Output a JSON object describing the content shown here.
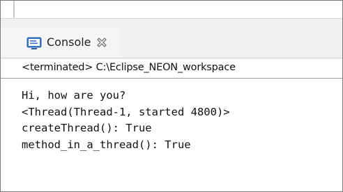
{
  "console_view": {
    "tab_label": "Console",
    "tab_icon": "console-icon",
    "close_icon": "close-icon",
    "status": "<terminated> C:\\Eclipse_NEON_workspace"
  },
  "output": {
    "lines": [
      "Hi, how are you?",
      "<Thread(Thread-1, started 4800)>",
      "createThread(): True",
      "method_in_a_thread(): True"
    ]
  },
  "colors": {
    "icon_blue": "#3a78c8",
    "tab_background": "#f5f5f5",
    "tab_bar_background": "#f1f1f1"
  }
}
